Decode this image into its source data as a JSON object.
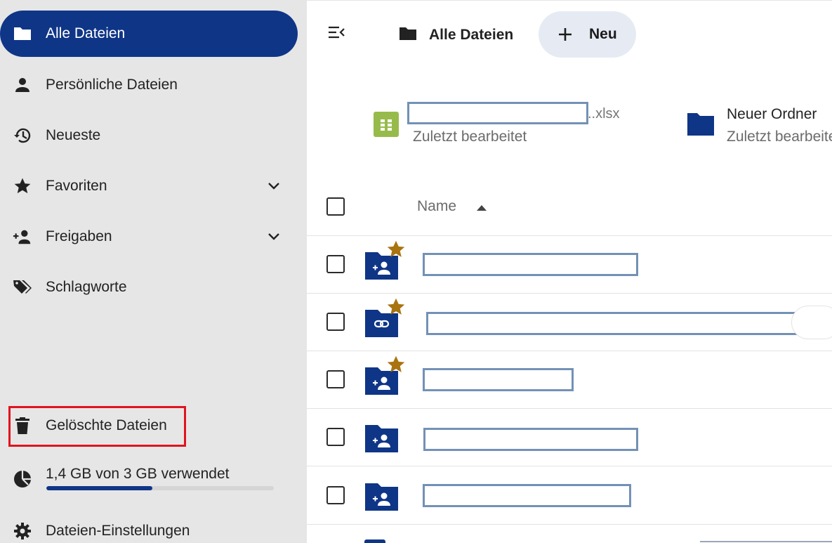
{
  "sidebar": {
    "items": [
      {
        "label": "Alle Dateien",
        "icon": "folder-icon",
        "active": true
      },
      {
        "label": "Persönliche Dateien",
        "icon": "person-icon"
      },
      {
        "label": "Neueste",
        "icon": "history-icon"
      },
      {
        "label": "Favoriten",
        "icon": "star-icon",
        "expandable": true
      },
      {
        "label": "Freigaben",
        "icon": "person-add-icon",
        "expandable": true
      },
      {
        "label": "Schlagworte",
        "icon": "tags-icon"
      }
    ],
    "trash": {
      "label": "Gelöschte Dateien",
      "icon": "trash-icon"
    },
    "quota": {
      "label": "1,4 GB von 3 GB verwendet",
      "used_fraction": 0.467,
      "icon": "pie-chart-icon"
    },
    "settings": {
      "label": "Dateien-Einstellungen",
      "icon": "gear-icon"
    },
    "accent_color": "#0f3587",
    "highlight_color": "#e0141e"
  },
  "header": {
    "breadcrumb": {
      "label": "Alle Dateien",
      "icon": "folder-icon"
    },
    "new_button": {
      "label": "Neu",
      "icon": "plus-icon"
    }
  },
  "recent": [
    {
      "ext": "..xlsx",
      "subtitle": "Zuletzt bearbeitet",
      "icon": "spreadsheet-icon"
    },
    {
      "title": "Neuer Ordner",
      "subtitle": "Zuletzt bearbeitet",
      "icon": "folder-icon"
    }
  ],
  "table": {
    "columns": {
      "name": "Name"
    },
    "sort_direction": "ascending",
    "rows": [
      {
        "type": "shared-folder",
        "favorite": true
      },
      {
        "type": "link-folder",
        "favorite": true
      },
      {
        "type": "shared-folder",
        "favorite": true
      },
      {
        "type": "shared-folder",
        "favorite": false
      },
      {
        "type": "shared-folder",
        "favorite": false
      }
    ]
  }
}
